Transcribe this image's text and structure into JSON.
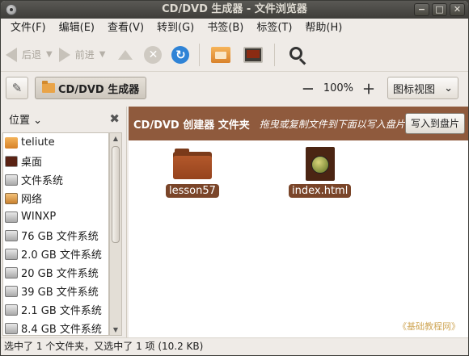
{
  "window": {
    "title": "CD/DVD 生成器 - 文件浏览器",
    "buttons": [
      "−",
      "□",
      "✕"
    ]
  },
  "menu": [
    "文件(F)",
    "编辑(E)",
    "查看(V)",
    "转到(G)",
    "书签(B)",
    "标签(T)",
    "帮助(H)"
  ],
  "toolbar": {
    "back_label": "后退",
    "forward_label": "前进"
  },
  "location": {
    "path": "CD/DVD 生成器",
    "zoom": "100%",
    "view_mode": "图标视图"
  },
  "sidebar": {
    "title": "位置",
    "items": [
      {
        "label": "teliute",
        "icon": "home"
      },
      {
        "label": "桌面",
        "icon": "desktop"
      },
      {
        "label": "文件系统",
        "icon": "drive"
      },
      {
        "label": "网络",
        "icon": "network"
      },
      {
        "label": "WINXP",
        "icon": "drive"
      },
      {
        "label": "76 GB 文件系统",
        "icon": "drive"
      },
      {
        "label": "2.0 GB 文件系统",
        "icon": "drive"
      },
      {
        "label": "20 GB 文件系统",
        "icon": "drive"
      },
      {
        "label": "39 GB 文件系统",
        "icon": "drive"
      },
      {
        "label": "2.1 GB 文件系统",
        "icon": "drive"
      },
      {
        "label": "8.4 GB 文件系统",
        "icon": "drive"
      }
    ]
  },
  "cd_bar": {
    "title": "CD/DVD 创建器 文件夹",
    "hint": "拖曳或复制文件到下面以写入盘片",
    "write_button": "写入到盘片"
  },
  "files": [
    {
      "name": "lesson57",
      "type": "folder"
    },
    {
      "name": "index.html",
      "type": "html"
    }
  ],
  "watermark": "《基础教程网》",
  "status": "选中了 1 个文件夹，又选中了 1 项 (10.2 KB)"
}
